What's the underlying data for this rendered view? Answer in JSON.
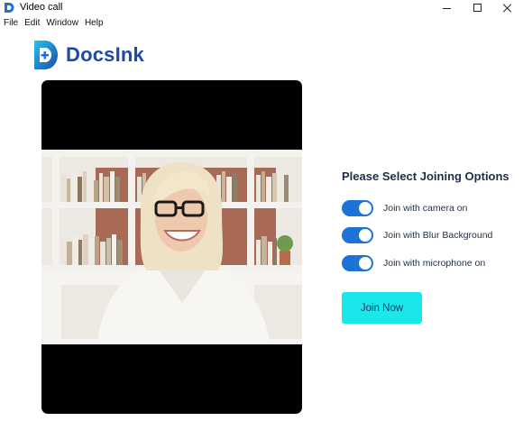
{
  "window": {
    "title": "Video call",
    "controls": {
      "minimize": "minimize-icon",
      "maximize": "maximize-icon",
      "close": "close-icon"
    }
  },
  "menu": {
    "items": [
      {
        "label": "File"
      },
      {
        "label": "Edit"
      },
      {
        "label": "Window"
      },
      {
        "label": "Help"
      }
    ]
  },
  "brand": {
    "name": "DocsInk",
    "color": "#1d4aa8",
    "icon": "docsink-logo-icon"
  },
  "video": {
    "content": "camera-preview"
  },
  "join_options": {
    "title": "Please Select Joining Options",
    "options": [
      {
        "label": "Join with camera on",
        "enabled": true
      },
      {
        "label": "Join with Blur Background",
        "enabled": true
      },
      {
        "label": "Join with microphone on",
        "enabled": true
      }
    ],
    "toggle_color": "#1d72d8"
  },
  "join_button": {
    "label": "Join Now",
    "color": "#19e7ea"
  }
}
